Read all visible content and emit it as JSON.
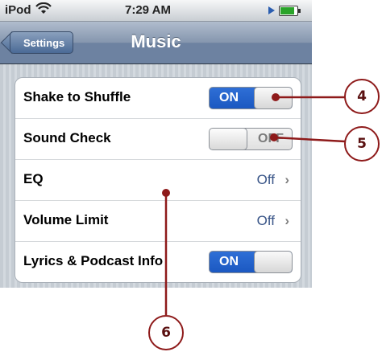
{
  "status_bar": {
    "carrier": "iPod",
    "time": "7:29 AM"
  },
  "nav": {
    "back_label": "Settings",
    "title": "Music"
  },
  "rows": [
    {
      "label": "Shake to Shuffle",
      "switch": "ON"
    },
    {
      "label": "Sound Check",
      "switch": "OFF"
    },
    {
      "label": "EQ",
      "value": "Off",
      "chevron": "›"
    },
    {
      "label": "Volume Limit",
      "value": "Off",
      "chevron": "›"
    },
    {
      "label": "Lyrics & Podcast Info",
      "switch": "ON"
    }
  ],
  "callouts": [
    "4",
    "5",
    "6"
  ],
  "colors": {
    "callout": "#8e1a1a",
    "switch_on": "#1b58c1",
    "nav_bar": "#6d82a1",
    "value_text": "#385487"
  },
  "icons": [
    "wifi-icon",
    "play-icon",
    "battery-icon",
    "chevron-right-icon"
  ]
}
